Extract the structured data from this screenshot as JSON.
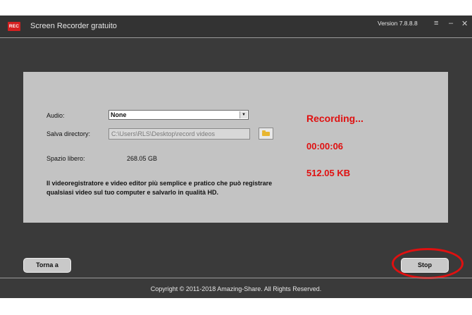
{
  "titlebar": {
    "logo_text": "REC",
    "title": "Screen Recorder gratuito",
    "version": "Version 7.8.8.8",
    "menu_glyph": "≡",
    "minimize_glyph": "–",
    "close_glyph": "✕"
  },
  "form": {
    "audio_label": "Audio:",
    "audio_value": "None",
    "dir_label": "Salva directory:",
    "dir_value": "C:\\Users\\RLS\\Desktop\\record videos",
    "free_label": "Spazio libero:",
    "free_value": "268.05 GB",
    "description": "Il videoregistratore e video editor più semplice e pratico che può registrare qualsiasi video sul tuo computer e salvarlo in qualità HD."
  },
  "status": {
    "recording": "Recording...",
    "timer": "00:00:06",
    "size": "512.05 KB",
    "color": "#e01010"
  },
  "buttons": {
    "back": "Torna a",
    "stop": "Stop"
  },
  "footer": {
    "copyright": "Copyright © 2011-2018 Amazing-Share. All Rights Reserved."
  },
  "icons": {
    "folder": "folder-icon",
    "dropdown": "chevron-down-icon"
  }
}
